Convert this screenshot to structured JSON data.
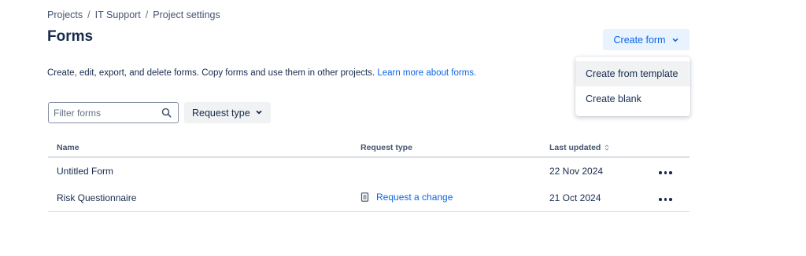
{
  "breadcrumb": {
    "items": [
      "Projects",
      "IT Support",
      "Project settings"
    ],
    "separator": "/"
  },
  "page_title": "Forms",
  "create_form_button": {
    "label": "Create form",
    "icon": "chevron-down-icon"
  },
  "description": {
    "text": "Create, edit, export, and delete forms. Copy forms and use them in other projects.",
    "link": "Learn more about forms."
  },
  "create_menu": {
    "items": [
      {
        "label": "Create from template",
        "highlighted": true
      },
      {
        "label": "Create blank",
        "highlighted": false
      }
    ]
  },
  "filter": {
    "placeholder": "Filter forms",
    "value": "",
    "icon": "search-icon"
  },
  "request_type_filter": {
    "label": "Request type",
    "icon": "chevron-down-icon"
  },
  "table": {
    "columns": [
      "Name",
      "Request type",
      "Last updated",
      ""
    ],
    "sort_icon": "sort-icon",
    "rows": [
      {
        "name": "Untitled Form",
        "request_type": "",
        "last_updated": "22 Nov 2024"
      },
      {
        "name": "Risk Questionnaire",
        "request_type": "Request a change",
        "request_type_icon": "document-icon",
        "last_updated": "21 Oct 2024"
      }
    ],
    "row_action_icon": "more-icon"
  },
  "colors": {
    "primary": "#0c66e4",
    "primary_subtle_bg": "#e9f2ff",
    "text": "#172b4d",
    "subtle_text": "#44546f",
    "border": "#dcdfe4"
  }
}
